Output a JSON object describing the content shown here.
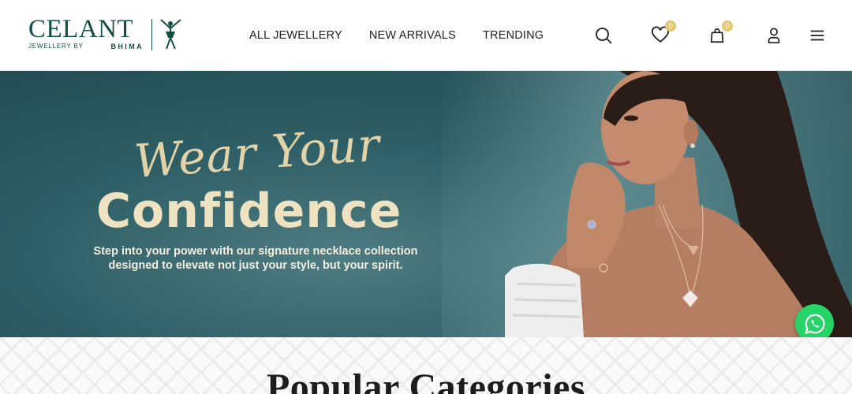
{
  "header": {
    "logo": {
      "wordmark": "CELANT",
      "by_text": "JEWELLERY BY",
      "brand_text": "BHIMA",
      "color": "#134e45"
    },
    "nav": [
      {
        "label": "ALL JEWELLERY"
      },
      {
        "label": "NEW ARRIVALS"
      },
      {
        "label": "TRENDING"
      }
    ],
    "icons": {
      "search": "search-icon",
      "wishlist": "heart-icon",
      "wishlist_count": "0",
      "cart": "shopping-bag-icon",
      "cart_count": "0",
      "account": "user-icon",
      "menu": "hamburger-menu-icon"
    },
    "badge_color": "#e3c773"
  },
  "hero": {
    "script_line": "Wear Your",
    "title": "Confidence",
    "description_line1": "Step into your power with our signature necklace collection",
    "description_line2": "designed to elevate not just your style, but your spirit.",
    "text_color": "#efe2c0",
    "background_color": "#2e5e65"
  },
  "whatsapp": {
    "icon": "whatsapp-icon",
    "color": "#25d366"
  },
  "categories": {
    "title": "Popular Categories"
  }
}
